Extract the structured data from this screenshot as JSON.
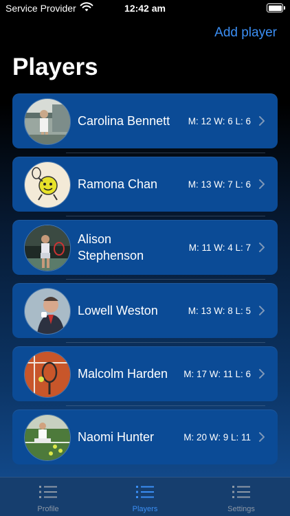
{
  "status_bar": {
    "carrier": "Service Provider",
    "time": "12:42 am"
  },
  "header": {
    "add_label": "Add player",
    "title": "Players"
  },
  "players": [
    {
      "name": "Carolina Bennett",
      "stats": "M: 12 W: 6 L: 6"
    },
    {
      "name": "Ramona Chan",
      "stats": "M: 13 W: 7 L: 6"
    },
    {
      "name": "Alison Stephenson",
      "stats": "M: 11 W: 4 L: 7"
    },
    {
      "name": "Lowell Weston",
      "stats": "M: 13 W: 8 L: 5"
    },
    {
      "name": "Malcolm Harden",
      "stats": "M: 17 W: 11 L: 6"
    },
    {
      "name": "Naomi Hunter",
      "stats": "M: 20 W: 9 L: 11"
    }
  ],
  "tabs": [
    {
      "label": "Profile",
      "icon": "list-icon",
      "active": false
    },
    {
      "label": "Players",
      "icon": "list-icon",
      "active": true
    },
    {
      "label": "Settings",
      "icon": "list-icon",
      "active": false
    }
  ],
  "colors": {
    "accent": "#3b8ff5",
    "card": "#0b4b96",
    "tabbar": "#163e6e",
    "inactive": "#8d98a6"
  }
}
